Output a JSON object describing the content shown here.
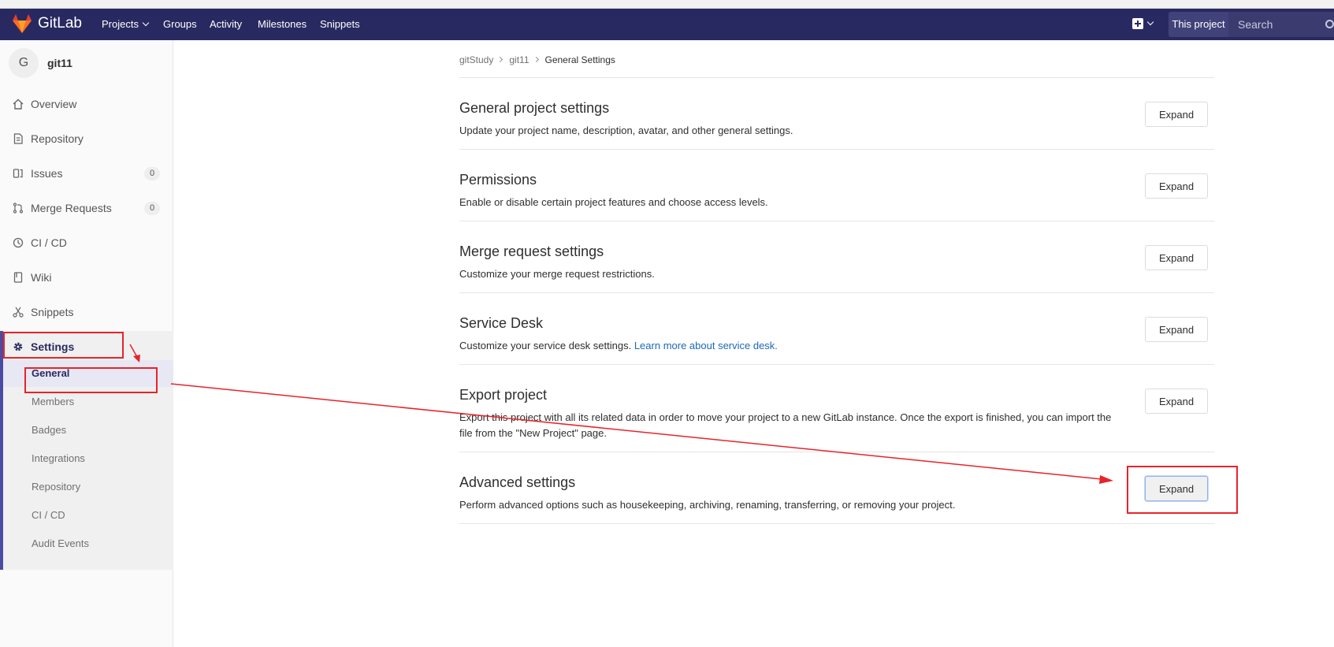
{
  "navbar": {
    "brand": "GitLab",
    "links": [
      "Projects",
      "Groups",
      "Activity",
      "Milestones",
      "Snippets"
    ],
    "scope_label": "This project",
    "search_placeholder": "Search"
  },
  "sidebar": {
    "avatar_letter": "G",
    "project_name": "git11",
    "items": [
      {
        "label": "Overview",
        "icon": "home-icon"
      },
      {
        "label": "Repository",
        "icon": "doc-icon"
      },
      {
        "label": "Issues",
        "icon": "issues-icon",
        "count": "0"
      },
      {
        "label": "Merge Requests",
        "icon": "merge-icon",
        "count": "0"
      },
      {
        "label": "CI / CD",
        "icon": "rocket-icon"
      },
      {
        "label": "Wiki",
        "icon": "book-icon"
      },
      {
        "label": "Snippets",
        "icon": "scissors-icon"
      }
    ],
    "settings_label": "Settings",
    "sub_items": [
      "General",
      "Members",
      "Badges",
      "Integrations",
      "Repository",
      "CI / CD",
      "Audit Events"
    ]
  },
  "breadcrumb": [
    "gitStudy",
    "git11",
    "General Settings"
  ],
  "sections": [
    {
      "title": "General project settings",
      "desc": "Update your project name, description, avatar, and other general settings.",
      "button": "Expand"
    },
    {
      "title": "Permissions",
      "desc": "Enable or disable certain project features and choose access levels.",
      "button": "Expand"
    },
    {
      "title": "Merge request settings",
      "desc": "Customize your merge request restrictions.",
      "button": "Expand"
    },
    {
      "title": "Service Desk",
      "desc": "Customize your service desk settings.",
      "link": "Learn more about service desk.",
      "button": "Expand"
    },
    {
      "title": "Export project",
      "desc": "Export this project with all its related data in order to move your project to a new GitLab instance. Once the export is finished, you can import the file from the \"New Project\" page.",
      "button": "Expand"
    },
    {
      "title": "Advanced settings",
      "desc": "Perform advanced options such as housekeeping, archiving, renaming, transferring, or removing your project.",
      "button": "Expand"
    }
  ],
  "colors": {
    "navbar": "#292961",
    "annotation": "#e8232a",
    "link": "#1b69b6"
  }
}
